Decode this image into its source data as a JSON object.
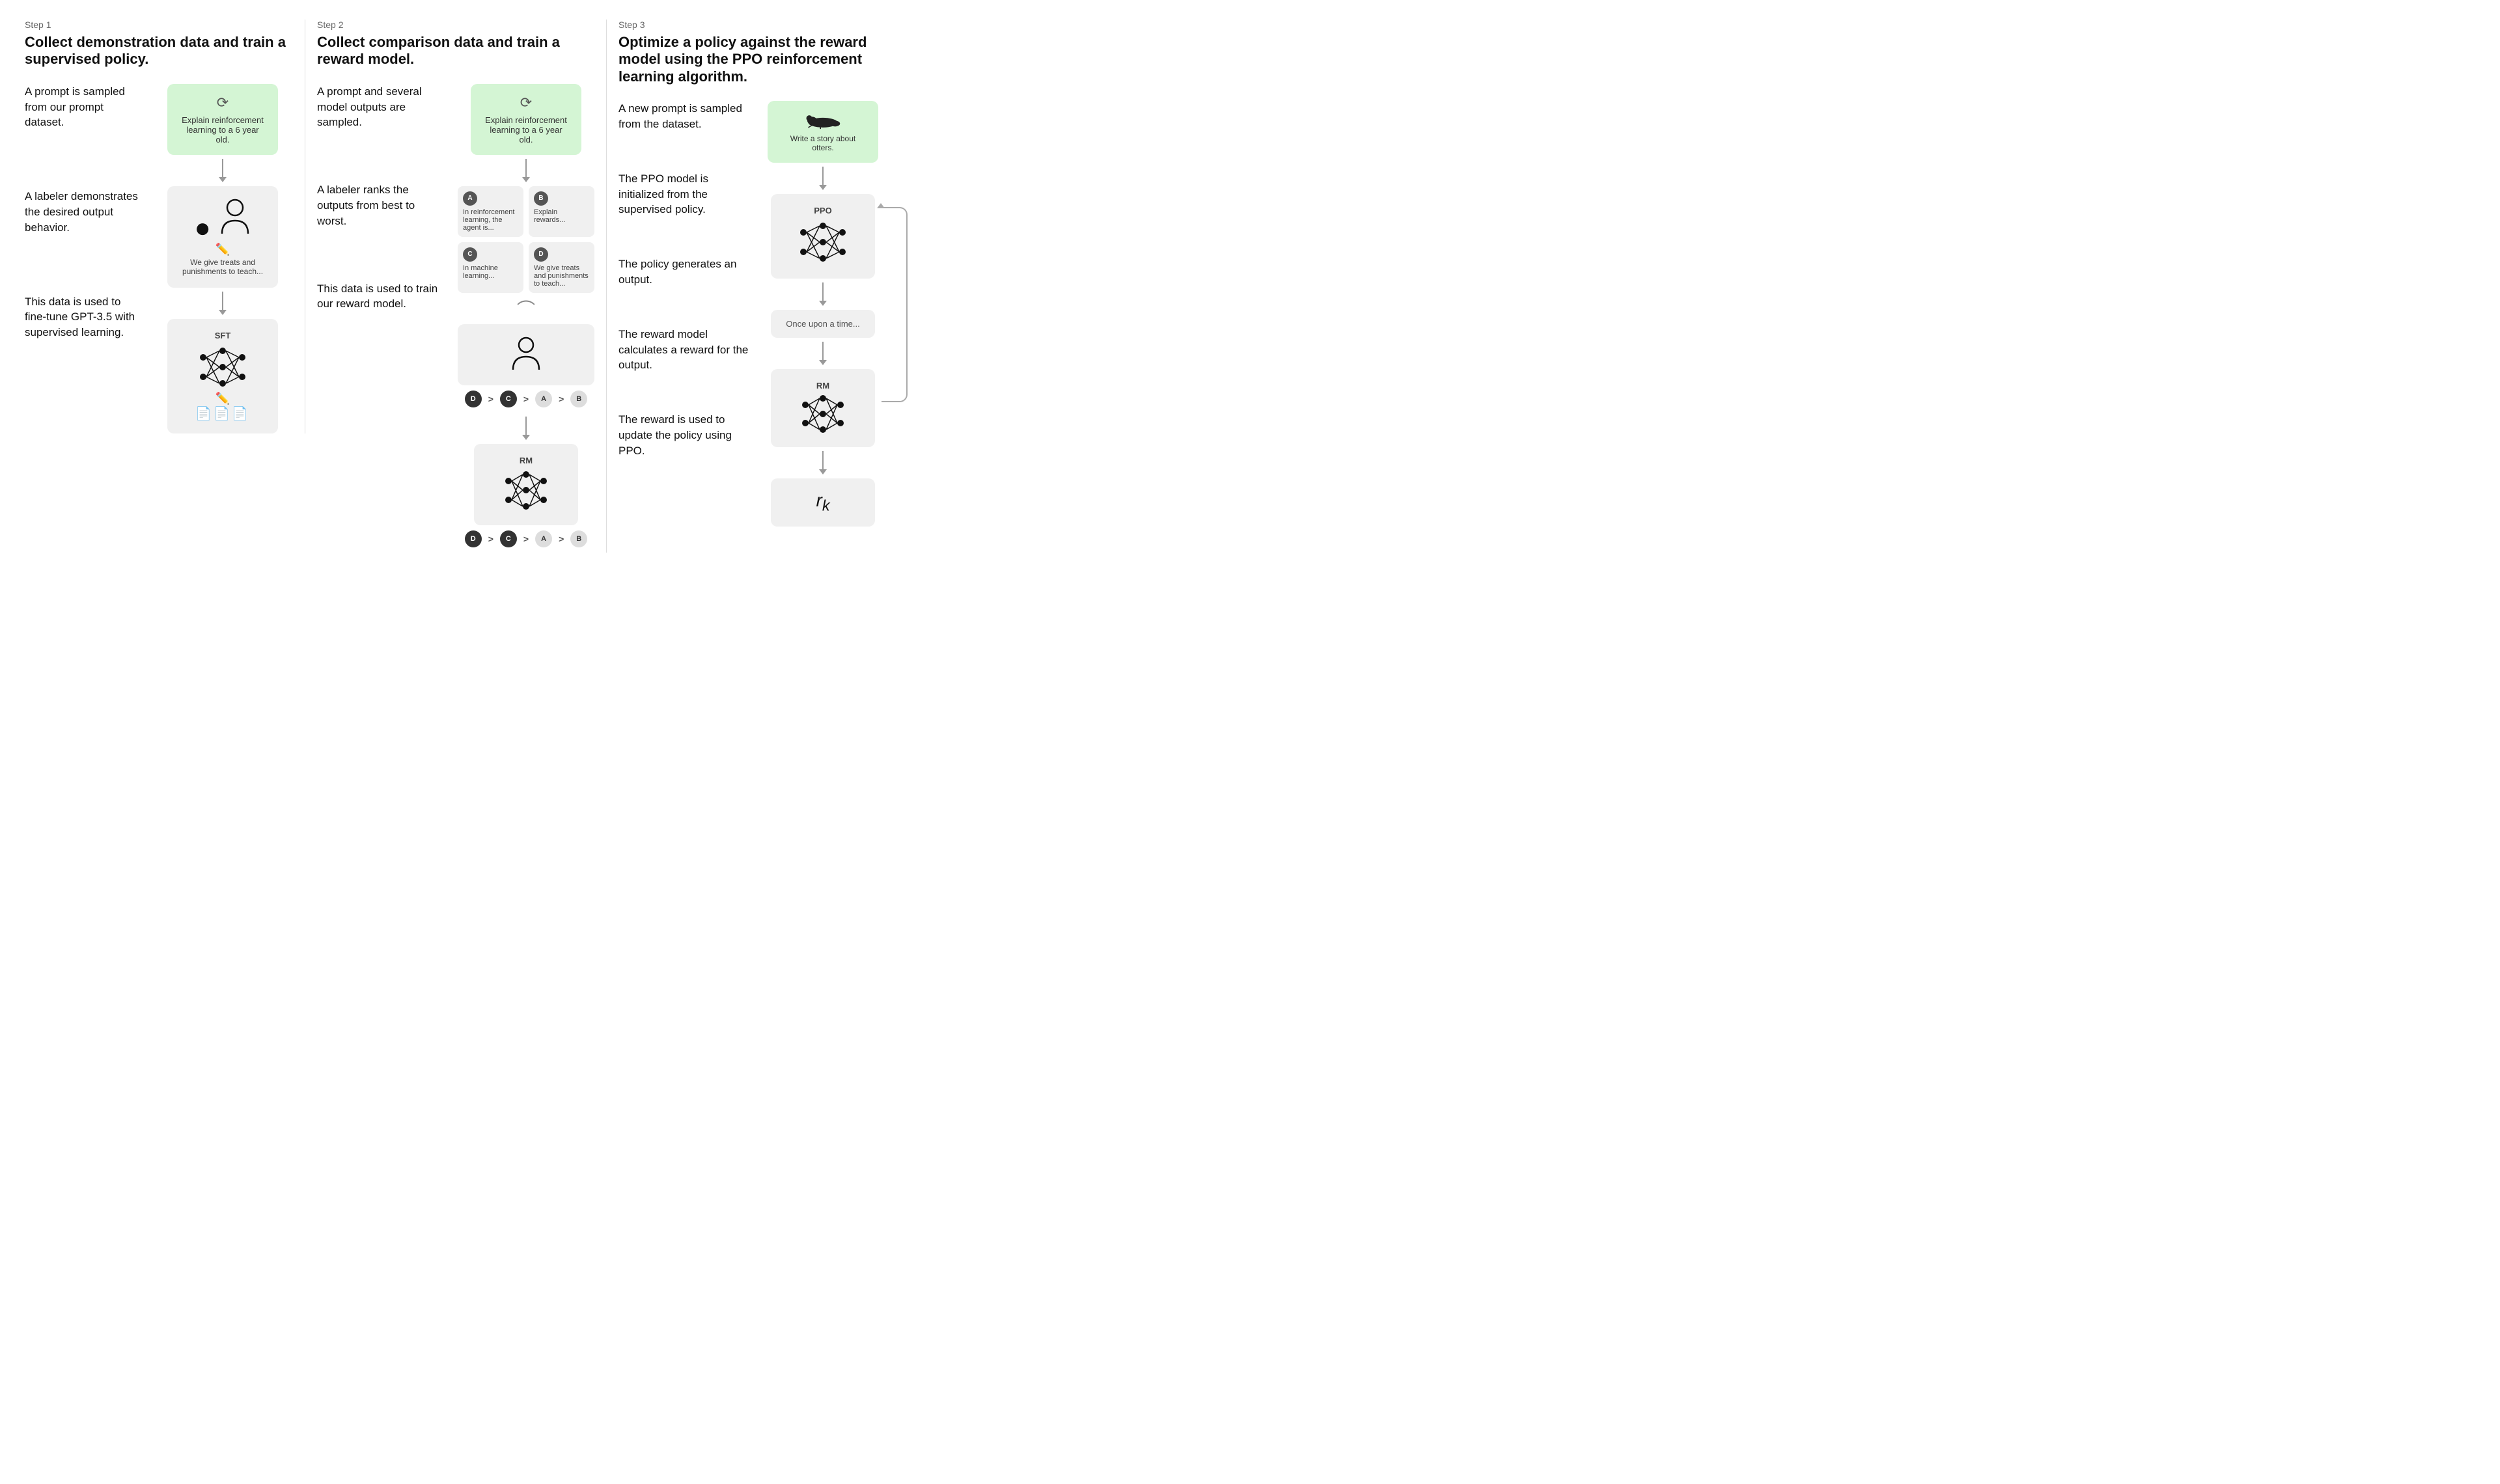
{
  "steps": [
    {
      "label": "Step 1",
      "title": "Collect demonstration data and train a supervised policy.",
      "left_texts": [
        "A prompt is sampled from our prompt dataset.",
        "A labeler demonstrates the desired output behavior.",
        "This data is used to fine-tune GPT-3.5 with supervised learning."
      ],
      "prompt_icon": "↻",
      "prompt_text": "Explain reinforcement learning to a 6 year old.",
      "labeler_caption": "We give treats and punishments to teach...",
      "model_label": "SFT"
    },
    {
      "label": "Step 2",
      "title": "Collect comparison data and train a reward model.",
      "left_texts": [
        "A prompt and several model outputs are sampled.",
        "A labeler ranks the outputs from best to worst.",
        "This data is used to train our reward model."
      ],
      "prompt_icon": "↻",
      "prompt_text": "Explain reinforcement learning to a 6 year old.",
      "outputs": [
        {
          "badge": "A",
          "text": "In reinforcement learning, the agent is..."
        },
        {
          "badge": "B",
          "text": "Explain rewards..."
        },
        {
          "badge": "C",
          "text": "In machine learning..."
        },
        {
          "badge": "D",
          "text": "We give treats and punishments to teach..."
        }
      ],
      "ranking": [
        "D",
        ">",
        "C",
        ">",
        "A",
        ">",
        "B"
      ],
      "model_label": "RM"
    },
    {
      "label": "Step 3",
      "title": "Optimize a policy against the reward model using the PPO reinforcement learning algorithm.",
      "left_texts": [
        "A new prompt is sampled from the dataset.",
        "The PPO model is initialized from the supervised policy.",
        "The policy generates an output.",
        "The reward model calculates a reward for the output.",
        "The reward is used to update the policy using PPO."
      ],
      "prompt_text": "Write a story about otters.",
      "ppo_label": "PPO",
      "output_text": "Once upon a time...",
      "rm_label": "RM",
      "rk_label": "r",
      "rk_sub": "k",
      "feedback_label": "feedback arrow"
    }
  ]
}
